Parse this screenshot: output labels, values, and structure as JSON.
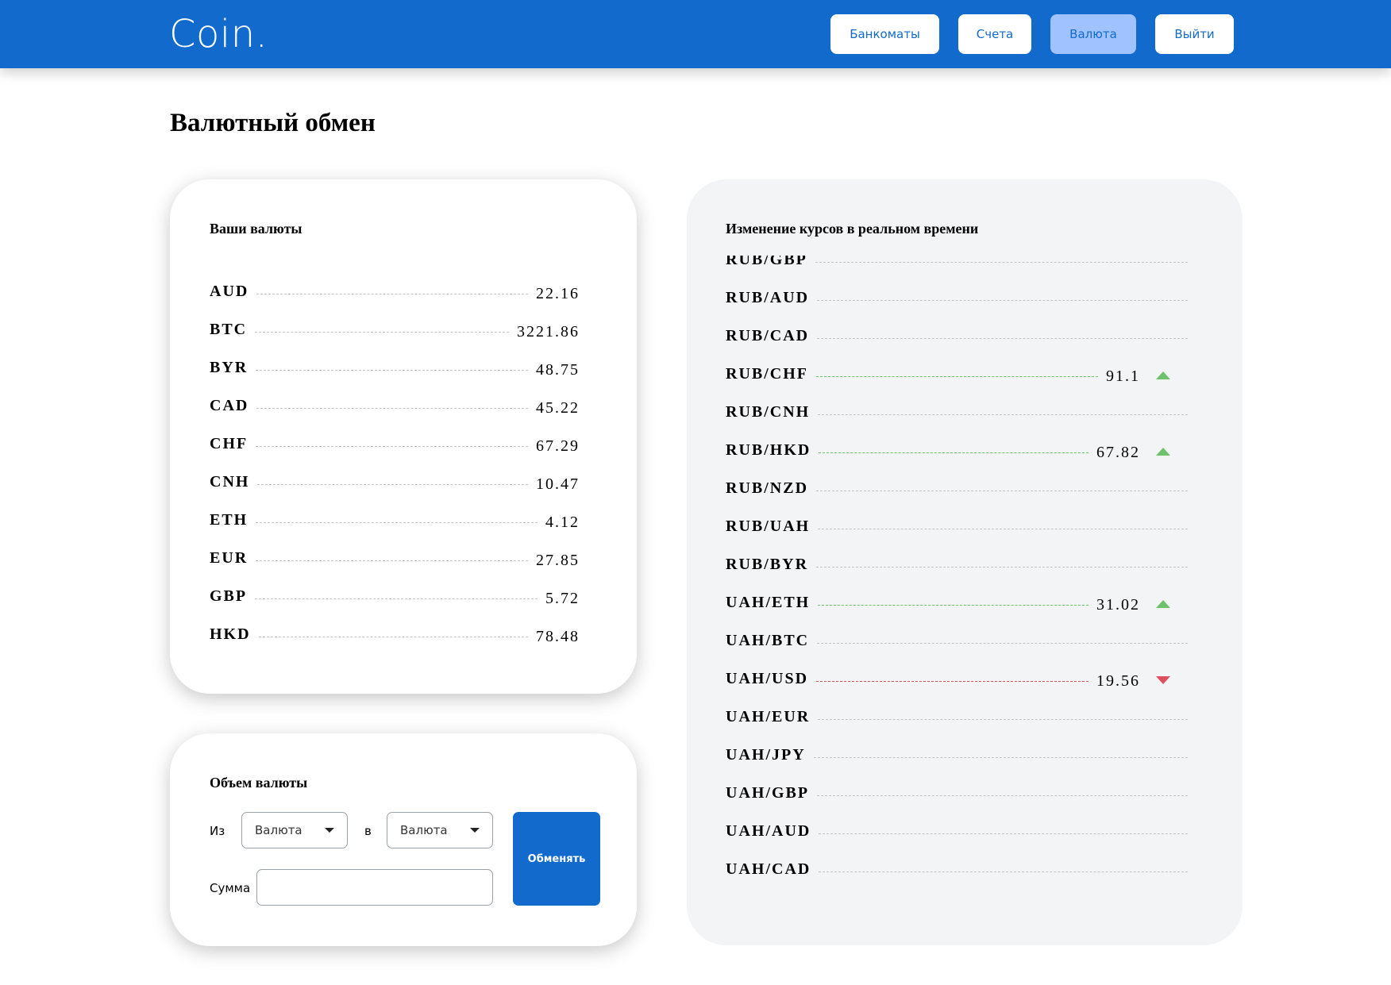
{
  "header": {
    "logo": "Coin.",
    "nav": [
      {
        "label": "Банкоматы",
        "active": false
      },
      {
        "label": "Счета",
        "active": false
      },
      {
        "label": "Валюта",
        "active": true
      },
      {
        "label": "Выйти",
        "active": false
      }
    ]
  },
  "page": {
    "title": "Валютный обмен"
  },
  "your_currencies": {
    "title": "Ваши валюты",
    "items": [
      {
        "code": "AUD",
        "amount": "22.16"
      },
      {
        "code": "BTC",
        "amount": "3221.86"
      },
      {
        "code": "BYR",
        "amount": "48.75"
      },
      {
        "code": "CAD",
        "amount": "45.22"
      },
      {
        "code": "CHF",
        "amount": "67.29"
      },
      {
        "code": "CNH",
        "amount": "10.47"
      },
      {
        "code": "ETH",
        "amount": "4.12"
      },
      {
        "code": "EUR",
        "amount": "27.85"
      },
      {
        "code": "GBP",
        "amount": "5.72"
      },
      {
        "code": "HKD",
        "amount": "78.48"
      }
    ]
  },
  "exchange_form": {
    "title": "Объем валюты",
    "from_label": "Из",
    "to_label": "в",
    "from_value": "Валюта",
    "to_value": "Валюта",
    "amount_label": "Сумма",
    "amount_value": "",
    "amount_placeholder": "",
    "submit_label": "Обменять"
  },
  "realtime_rates": {
    "title": "Изменение курсов в реальном времени",
    "items": [
      {
        "pair": "RUB/GBP",
        "rate": "",
        "trend": "none"
      },
      {
        "pair": "RUB/AUD",
        "rate": "",
        "trend": "none"
      },
      {
        "pair": "RUB/CAD",
        "rate": "",
        "trend": "none"
      },
      {
        "pair": "RUB/CHF",
        "rate": "91.1",
        "trend": "up"
      },
      {
        "pair": "RUB/CNH",
        "rate": "",
        "trend": "none"
      },
      {
        "pair": "RUB/HKD",
        "rate": "67.82",
        "trend": "up"
      },
      {
        "pair": "RUB/NZD",
        "rate": "",
        "trend": "none"
      },
      {
        "pair": "RUB/UAH",
        "rate": "",
        "trend": "none"
      },
      {
        "pair": "RUB/BYR",
        "rate": "",
        "trend": "none"
      },
      {
        "pair": "UAH/ETH",
        "rate": "31.02",
        "trend": "up"
      },
      {
        "pair": "UAH/BTC",
        "rate": "",
        "trend": "none"
      },
      {
        "pair": "UAH/USD",
        "rate": "19.56",
        "trend": "down"
      },
      {
        "pair": "UAH/EUR",
        "rate": "",
        "trend": "none"
      },
      {
        "pair": "UAH/JPY",
        "rate": "",
        "trend": "none"
      },
      {
        "pair": "UAH/GBP",
        "rate": "",
        "trend": "none"
      },
      {
        "pair": "UAH/AUD",
        "rate": "",
        "trend": "none"
      },
      {
        "pair": "UAH/CAD",
        "rate": "",
        "trend": "none"
      }
    ]
  },
  "colors": {
    "brand": "#116acc",
    "active_nav": "#a0c3ff",
    "up": "#6dc36d",
    "down": "#e04f5f",
    "panel_grey": "#f3f4f6"
  }
}
